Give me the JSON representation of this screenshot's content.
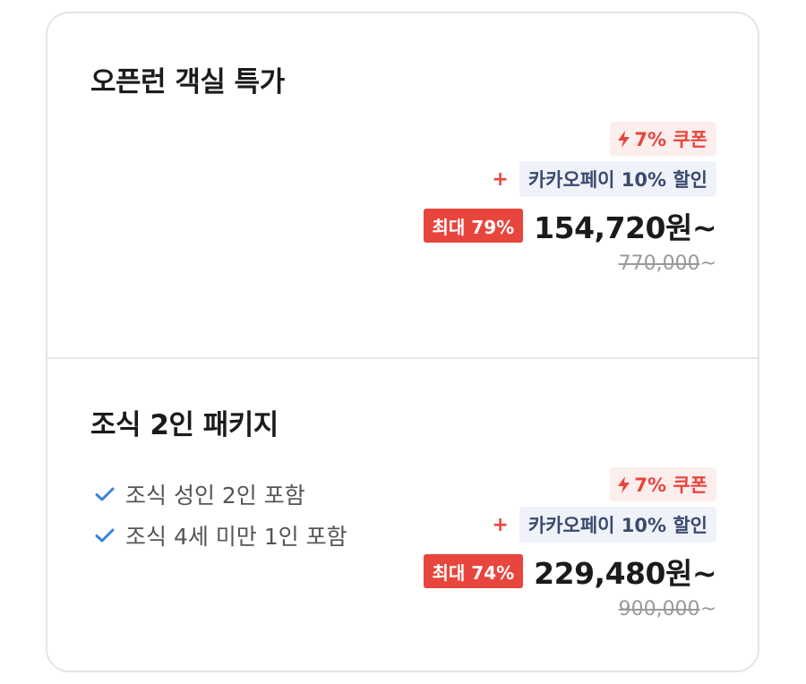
{
  "offers": [
    {
      "title": "오픈런 객실 특가",
      "features": [],
      "coupon_label": "7% 쿠폰",
      "plus_sign": "+",
      "pay_label": "카카오페이 10% 할인",
      "discount_label": "최대 79%",
      "price": "154,720원~",
      "original_price": "770,000",
      "original_suffix": "~"
    },
    {
      "title": "조식 2인 패키지",
      "features": [
        "조식 성인 2인 포함",
        "조식 4세 미만 1인 포함"
      ],
      "coupon_label": "7% 쿠폰",
      "plus_sign": "+",
      "pay_label": "카카오페이 10% 할인",
      "discount_label": "최대 74%",
      "price": "229,480원~",
      "original_price": "900,000",
      "original_suffix": "~"
    }
  ],
  "colors": {
    "accent_red": "#e8453c",
    "coupon_bg": "#fdeeee",
    "pay_bg": "#eff2f9",
    "pay_text": "#3b4a6c",
    "check_blue": "#3b82e0"
  },
  "icons": {
    "coupon": "lightning-bolt-icon",
    "feature": "checkmark-icon"
  }
}
